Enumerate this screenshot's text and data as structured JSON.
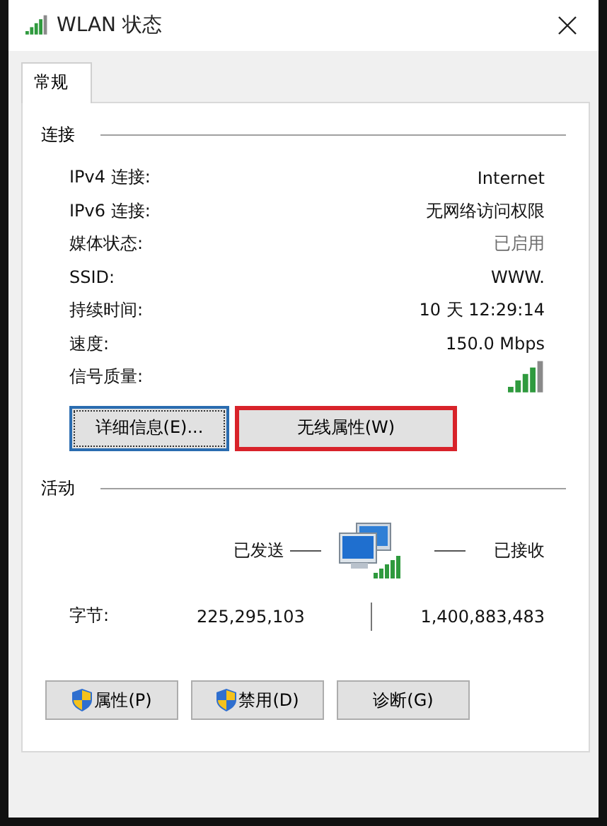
{
  "window": {
    "title": "WLAN 状态"
  },
  "tabs": [
    {
      "label": "常规",
      "selected": true
    }
  ],
  "connection": {
    "heading": "连接",
    "rows": [
      {
        "kind": "text",
        "label": "IPv4 连接:",
        "value": "Internet"
      },
      {
        "kind": "text",
        "label": "IPv6 连接:",
        "value": "无网络访问权限"
      },
      {
        "kind": "text",
        "label": "媒体状态:",
        "value": "已启用",
        "disabled": true
      },
      {
        "kind": "text",
        "label": "SSID:",
        "value": "WWW."
      },
      {
        "kind": "text",
        "label": "持续时间:",
        "value": "10 天 12:29:14"
      },
      {
        "kind": "text",
        "label": "速度:",
        "value": "150.0 Mbps"
      },
      {
        "kind": "signal",
        "label": "信号质量:"
      }
    ],
    "buttons": [
      {
        "label": "详细信息(E)...",
        "focused": true,
        "highlighted": false
      },
      {
        "label": "无线属性(W)",
        "focused": false,
        "highlighted": true
      }
    ]
  },
  "activity": {
    "heading": "活动",
    "sent_label": "已发送",
    "received_label": "已接收",
    "bytes_label": "字节:",
    "bytes_sent": "225,295,103",
    "bytes_received": "1,400,883,483"
  },
  "footer_buttons": [
    {
      "label": "属性(P)",
      "shield": true
    },
    {
      "label": "禁用(D)",
      "shield": true
    },
    {
      "label": "诊断(G)",
      "shield": false
    }
  ]
}
